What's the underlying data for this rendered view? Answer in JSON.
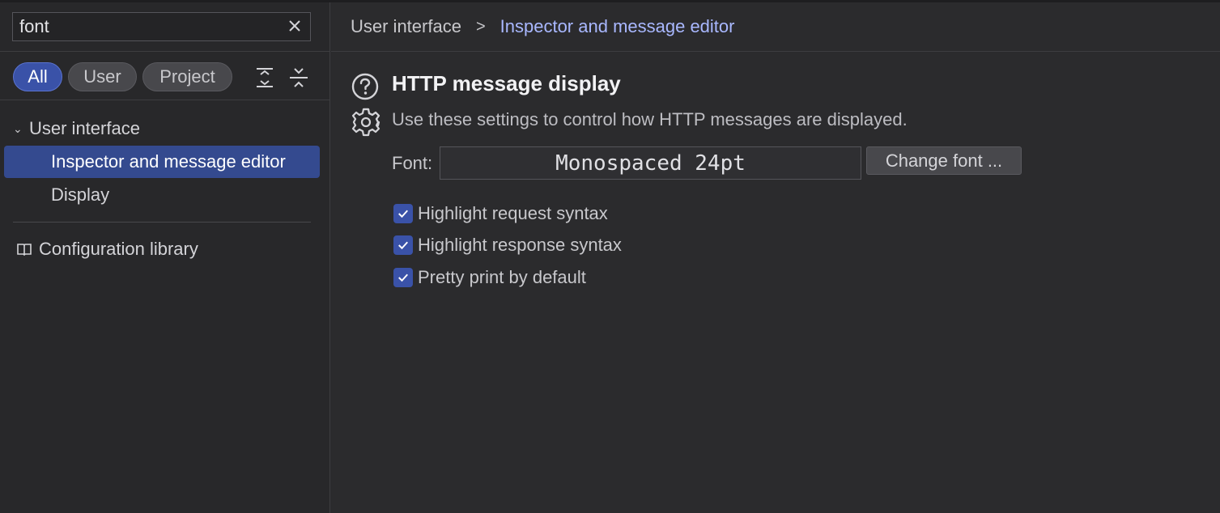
{
  "search": {
    "value": "font"
  },
  "filters": {
    "all": "All",
    "user": "User",
    "project": "Project"
  },
  "tree": {
    "group_label": "User interface",
    "items": [
      {
        "label": "Inspector and message editor",
        "selected": true
      },
      {
        "label": "Display",
        "selected": false
      }
    ],
    "library_label": "Configuration library"
  },
  "breadcrumb": {
    "parent": "User interface",
    "separator": ">",
    "current": "Inspector and message editor"
  },
  "section": {
    "title": "HTTP message display",
    "description": "Use these settings to control how HTTP messages are displayed."
  },
  "font_setting": {
    "label": "Font:",
    "value": "Monospaced 24pt",
    "button_label": "Change font ..."
  },
  "checkboxes": [
    {
      "label": "Highlight request syntax",
      "checked": true
    },
    {
      "label": "Highlight response syntax",
      "checked": true
    },
    {
      "label": "Pretty print by default",
      "checked": true
    }
  ],
  "colors": {
    "accent": "#3a52a8",
    "breadcrumb_current": "#a9b8ff",
    "background": "#2b2b2d"
  }
}
